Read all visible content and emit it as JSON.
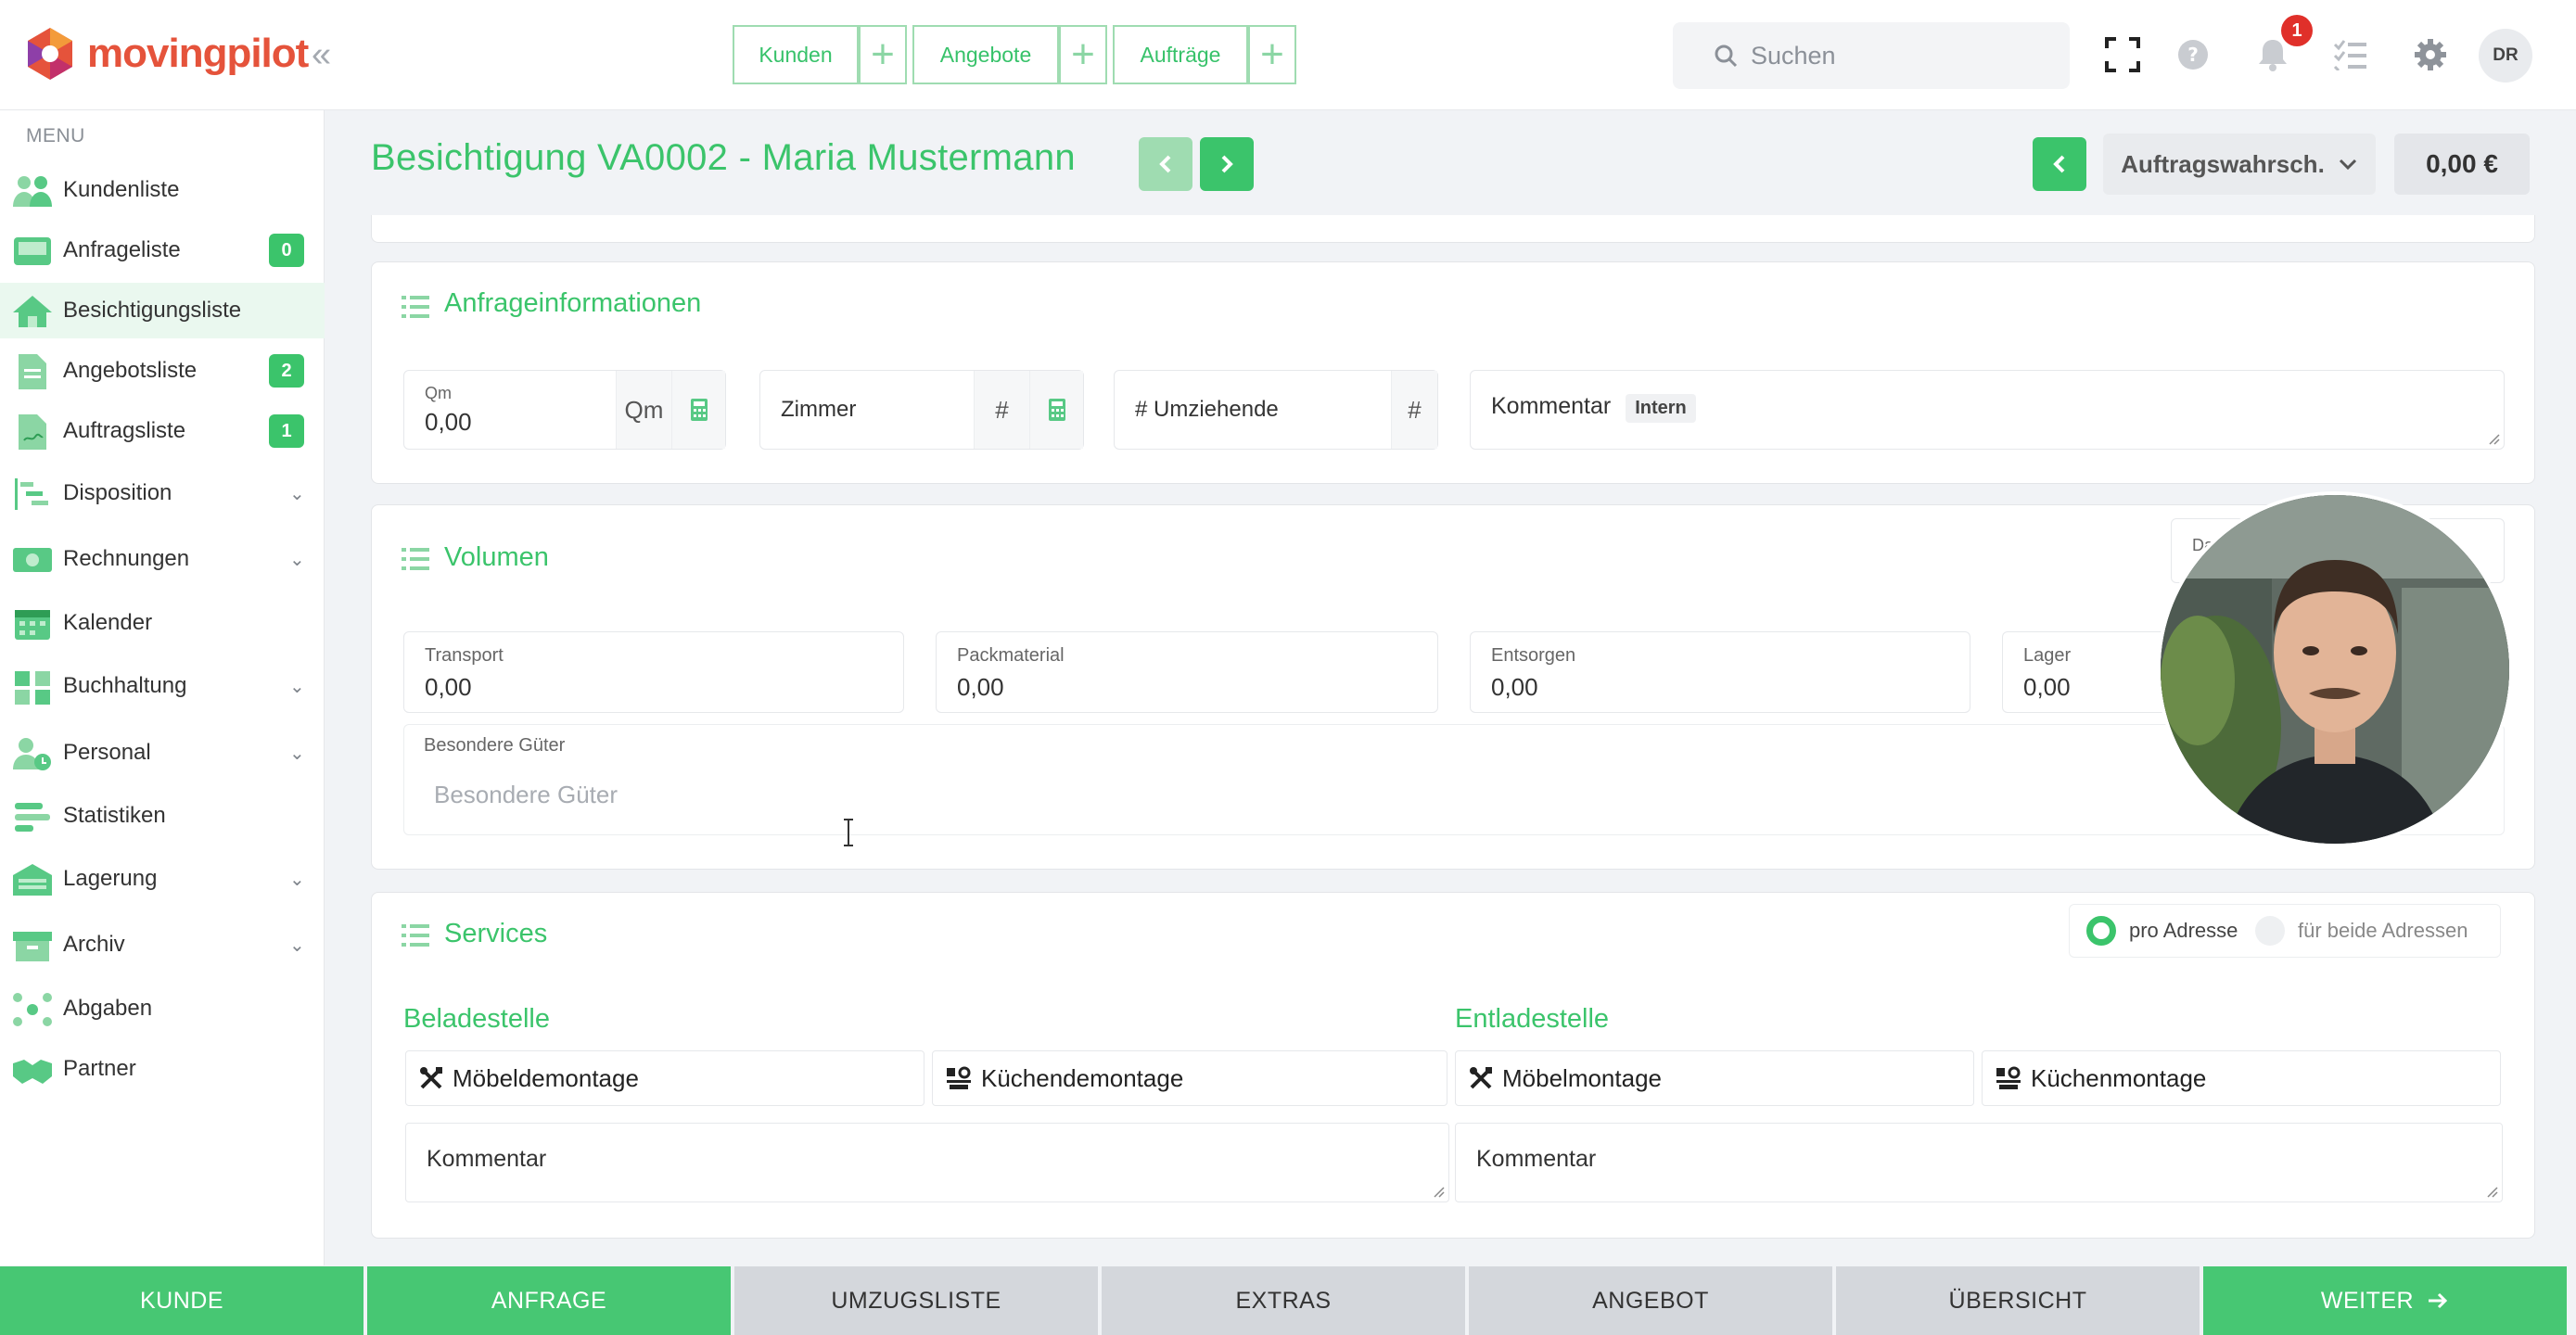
{
  "app": {
    "name": "movingpilot"
  },
  "topbar": {
    "quick_actions": [
      {
        "label": "Kunden",
        "plus": "+"
      },
      {
        "label": "Angebote",
        "plus": "+"
      },
      {
        "label": "Aufträge",
        "plus": "+"
      }
    ],
    "search_placeholder": "Suchen",
    "notification_count": "1",
    "user_initials": "DR"
  },
  "sidebar": {
    "menu_label": "MENU",
    "items": [
      {
        "label": "Kundenliste",
        "icon": "users-icon"
      },
      {
        "label": "Anfrageliste",
        "icon": "inbox-icon",
        "badge": "0"
      },
      {
        "label": "Besichtigungsliste",
        "icon": "house-icon",
        "active": true
      },
      {
        "label": "Angebotsliste",
        "icon": "document-icon",
        "badge": "2"
      },
      {
        "label": "Auftragsliste",
        "icon": "contract-icon",
        "badge": "1"
      },
      {
        "label": "Disposition",
        "icon": "gantt-icon",
        "chevron": true
      },
      {
        "label": "Rechnungen",
        "icon": "money-icon",
        "chevron": true
      },
      {
        "label": "Kalender",
        "icon": "calendar-icon"
      },
      {
        "label": "Buchhaltung",
        "icon": "calculator-icon",
        "chevron": true
      },
      {
        "label": "Personal",
        "icon": "person-clock-icon",
        "chevron": true
      },
      {
        "label": "Statistiken",
        "icon": "statistics-icon"
      },
      {
        "label": "Lagerung",
        "icon": "warehouse-icon",
        "chevron": true
      },
      {
        "label": "Archiv",
        "icon": "archive-icon",
        "chevron": true
      },
      {
        "label": "Abgaben",
        "icon": "network-icon"
      },
      {
        "label": "Partner",
        "icon": "handshake-icon"
      }
    ]
  },
  "header": {
    "title": "Besichtigung VA0002 - Maria Mustermann",
    "probability_label": "Auftragswahrsch.",
    "price": "0,00 €"
  },
  "request_info": {
    "title": "Anfrageinformationen",
    "qm_label": "Qm",
    "qm_value": "0,00",
    "qm_unit": "Qm",
    "rooms_label": "Zimmer",
    "rooms_unit": "#",
    "movers_label": "# Umziehende",
    "movers_unit": "#",
    "comment_label": "Kommentar",
    "comment_tag": "Intern"
  },
  "volume": {
    "title": "Volumen",
    "date_label_partial": "Dat",
    "fields": [
      {
        "label": "Transport",
        "value": "0,00"
      },
      {
        "label": "Packmaterial",
        "value": "0,00"
      },
      {
        "label": "Entsorgen",
        "value": "0,00"
      },
      {
        "label": "Lager",
        "value": "0,00"
      }
    ],
    "special_goods_label": "Besondere Güter",
    "special_goods_placeholder": "Besondere Güter"
  },
  "services": {
    "title": "Services",
    "radio_per_address": "pro Adresse",
    "radio_both": "für beide Adressen",
    "loading": {
      "title": "Beladestelle",
      "furniture": "Möbeldemontage",
      "kitchen": "Küchendemontage",
      "comment": "Kommentar"
    },
    "unloading": {
      "title": "Entladestelle",
      "furniture": "Möbelmontage",
      "kitchen": "Küchenmontage",
      "comment": "Kommentar"
    }
  },
  "steps": [
    {
      "label": "KUNDE",
      "style": "green"
    },
    {
      "label": "ANFRAGE",
      "style": "green"
    },
    {
      "label": "UMZUGSLISTE",
      "style": "gray"
    },
    {
      "label": "EXTRAS",
      "style": "gray"
    },
    {
      "label": "ANGEBOT",
      "style": "gray"
    },
    {
      "label": "ÜBERSICHT",
      "style": "gray"
    },
    {
      "label": "WEITER",
      "style": "green"
    }
  ],
  "colors": {
    "accent": "#3bc46b",
    "brand": "#e5533b",
    "step_gray": "#d4d7dc",
    "badge_red": "#e0302a"
  }
}
